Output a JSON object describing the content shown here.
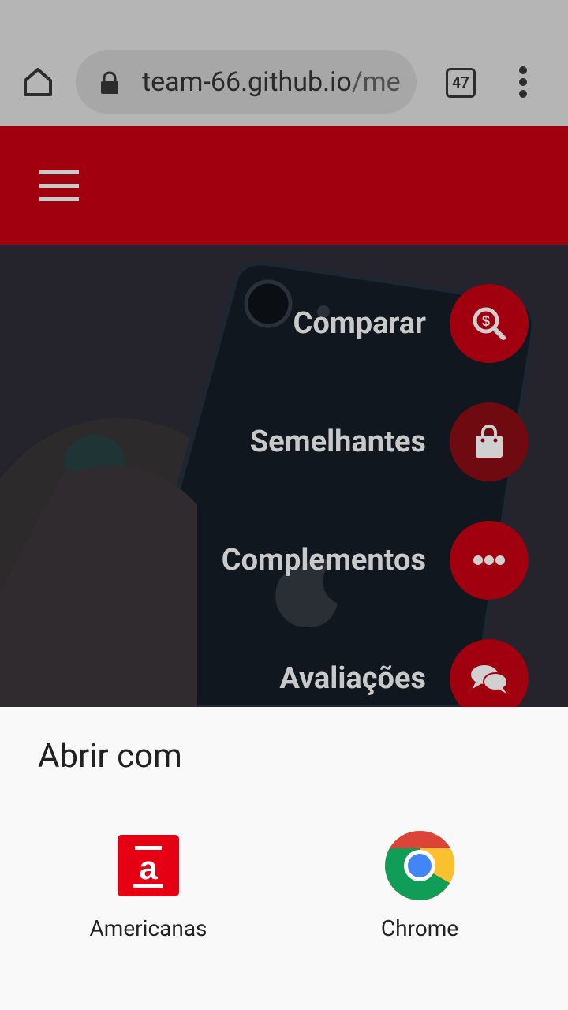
{
  "browser": {
    "url_host": "team-66.github.io",
    "url_path": "/me",
    "tab_count": "47"
  },
  "fab_menu": {
    "items": [
      {
        "label": "Comparar",
        "icon": "search-dollar-icon"
      },
      {
        "label": "Semelhantes",
        "icon": "shopping-bag-icon"
      },
      {
        "label": "Complementos",
        "icon": "ellipsis-icon"
      },
      {
        "label": "Avaliações",
        "icon": "comments-icon"
      }
    ]
  },
  "sheet": {
    "title": "Abrir com",
    "apps": [
      {
        "name": "Americanas",
        "icon": "americanas-app-icon"
      },
      {
        "name": "Chrome",
        "icon": "chrome-app-icon"
      }
    ]
  },
  "colors": {
    "header_red": "#a1010e",
    "fab_red": "#a1010e",
    "fab_dark": "#6f0a10",
    "browser_bar": "#b5b5b5",
    "sheet_bg": "#f9f9f9"
  }
}
